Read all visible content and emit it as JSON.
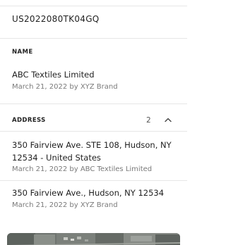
{
  "record": {
    "id": "US2022080TK04GQ"
  },
  "name_section": {
    "label": "NAME",
    "entries": [
      {
        "value": "ABC Textiles Limited",
        "meta": "March 21, 2022 by XYZ Brand"
      }
    ]
  },
  "address_section": {
    "label": "ADDRESS",
    "count": "2",
    "expanded_icon": "chevron-up-icon",
    "entries": [
      {
        "value": "350 Fairview Ave. STE 108, Hudson, NY 12534 - United States",
        "meta": "March 21, 2022 by ABC Textiles Limited"
      },
      {
        "value": "350 Fairview Ave., Hudson, NY 12534",
        "meta": "March 21, 2022 by XYZ Brand"
      }
    ]
  },
  "map": {
    "icon": "satellite-map-thumbnail",
    "colors": {
      "base": "#6f7470"
    }
  }
}
